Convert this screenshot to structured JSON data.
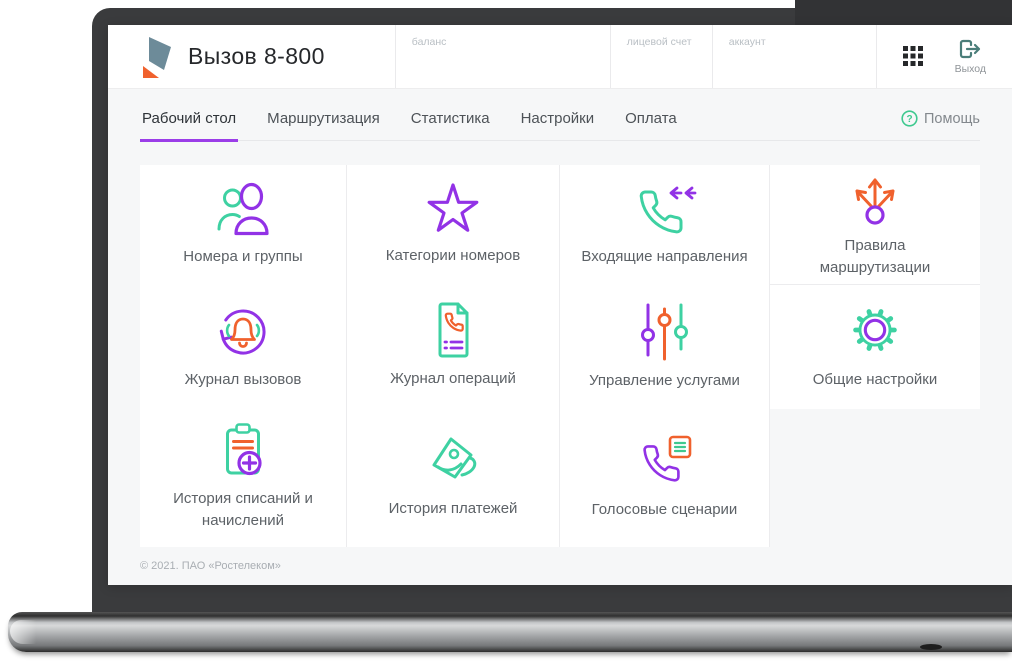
{
  "app": {
    "title": "Вызов 8-800"
  },
  "header": {
    "fields": [
      {
        "label": "баланс"
      },
      {
        "label": "лицевой счет"
      },
      {
        "label": "аккаунт"
      }
    ],
    "logout_label": "Выход"
  },
  "nav": {
    "tabs": [
      {
        "label": "Рабочий стол",
        "active": true
      },
      {
        "label": "Маршрутизация",
        "active": false
      },
      {
        "label": "Статистика",
        "active": false
      },
      {
        "label": "Настройки",
        "active": false
      },
      {
        "label": "Оплата",
        "active": false
      }
    ],
    "help_label": "Помощь"
  },
  "tiles": [
    {
      "label": "Номера и группы",
      "icon": "users-icon"
    },
    {
      "label": "Категории номеров",
      "icon": "star-icon"
    },
    {
      "label": "Входящие направления",
      "icon": "incoming-call-icon"
    },
    {
      "label": "Правила маршрутизации",
      "icon": "routing-icon"
    },
    {
      "label": "Журнал вызовов",
      "icon": "call-log-icon"
    },
    {
      "label": "Журнал операций",
      "icon": "operations-log-icon"
    },
    {
      "label": "Управление услугами",
      "icon": "sliders-icon"
    },
    {
      "label": "Общие настройки",
      "icon": "gear-icon"
    },
    {
      "label": "История списаний и начислений",
      "icon": "clipboard-plus-icon"
    },
    {
      "label": "История платежей",
      "icon": "wallet-icon"
    },
    {
      "label": "Голосовые сценарии",
      "icon": "voice-script-icon"
    }
  ],
  "footer": {
    "copyright": "© 2021. ПАО «Ростелеком»"
  },
  "colors": {
    "teal": "#3ED1A2",
    "purple": "#9232E6",
    "orange": "#F0612D",
    "underline": "#9B3DE8",
    "help-green": "#3EC98F",
    "logout-teal": "#4A7D79"
  }
}
